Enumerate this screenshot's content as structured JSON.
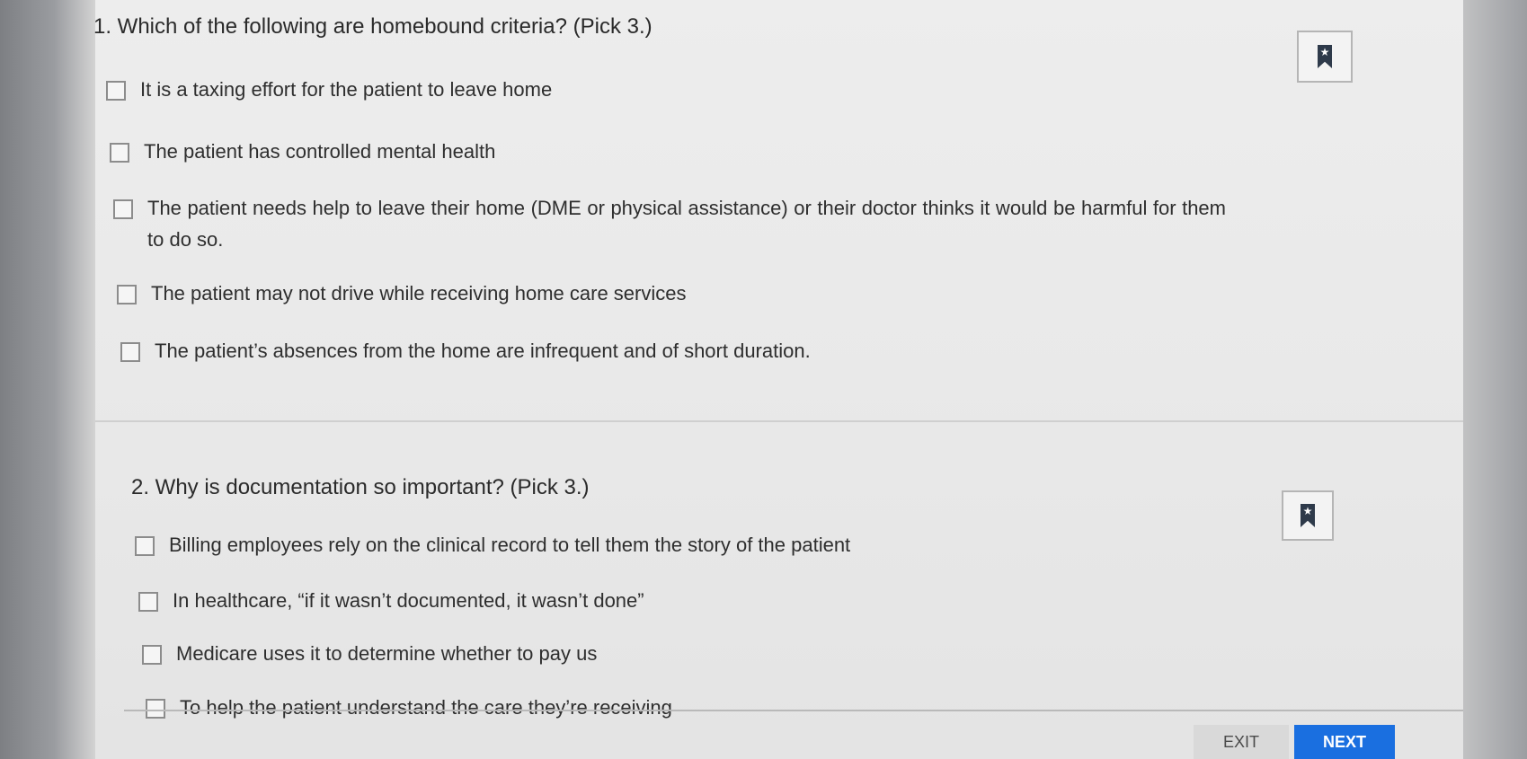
{
  "questions": [
    {
      "title": "1. Which of the following are homebound criteria? (Pick 3.)",
      "options": [
        "It is a taxing effort for the patient to leave home",
        "The patient has controlled mental health",
        "The patient needs help to leave their home (DME or physical assistance) or their doctor thinks it would be harmful for them to do so.",
        "The patient may not drive while receiving home care services",
        "The patient’s absences from the home are infrequent and of short duration."
      ]
    },
    {
      "title": "2. Why is documentation so important? (Pick 3.)",
      "options": [
        "Billing employees rely on the clinical record to tell them the story of the patient",
        "In healthcare, “if it wasn’t documented, it wasn’t done”",
        "Medicare uses it to determine whether to pay us",
        "To help the patient understand the care they’re receiving"
      ]
    }
  ],
  "bookmark_icon": "bookmark-star-icon",
  "footer": {
    "exit_label": "EXIT",
    "next_label": "NEXT"
  },
  "colors": {
    "next_button": "#1a6fe0",
    "exit_button": "#d9d9d9"
  }
}
